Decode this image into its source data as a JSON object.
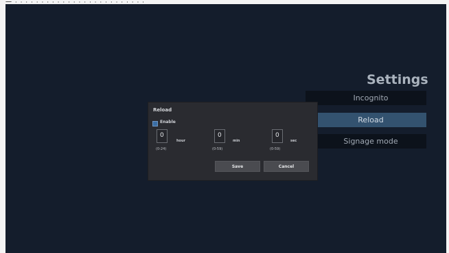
{
  "top_caption": "一 · ·  ·  · · ·  · · ·  · · ·  · · · ·  ·  · · · · ·  · · ·",
  "settings": {
    "title": "Settings",
    "menu": [
      {
        "label": "Incognito",
        "selected": false
      },
      {
        "label": "Reload",
        "selected": true
      },
      {
        "label": "Signage mode",
        "selected": false
      }
    ]
  },
  "dialog": {
    "title": "Reload",
    "enable_label": "Enable",
    "enable_checked": true,
    "fields": [
      {
        "value": "0",
        "unit": "hour",
        "range": "(0-24)"
      },
      {
        "value": "0",
        "unit": "min",
        "range": "(0-59)"
      },
      {
        "value": "0",
        "unit": "sec",
        "range": "(0-59)"
      }
    ],
    "save_label": "Save",
    "cancel_label": "Cancel"
  },
  "colors": {
    "screen_bg": "#141d2c",
    "menu_selected": "#33526f",
    "dialog_bg": "#2a2b30"
  }
}
